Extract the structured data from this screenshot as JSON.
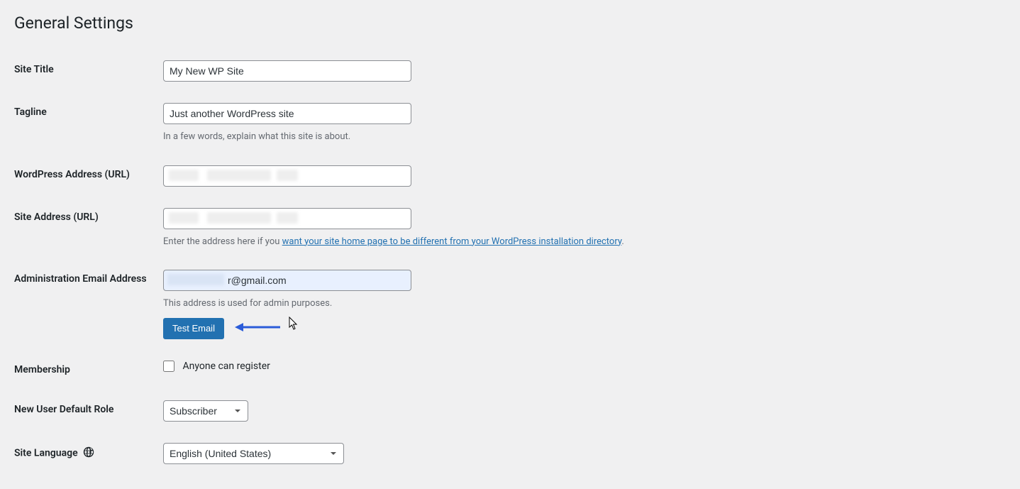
{
  "page_title": "General Settings",
  "fields": {
    "site_title": {
      "label": "Site Title",
      "value": "My New WP Site"
    },
    "tagline": {
      "label": "Tagline",
      "value": "Just another WordPress site",
      "description": "In a few words, explain what this site is about."
    },
    "wp_address": {
      "label": "WordPress Address (URL)",
      "value": ""
    },
    "site_address": {
      "label": "Site Address (URL)",
      "value": "",
      "desc_prefix": "Enter the address here if you ",
      "desc_link": "want your site home page to be different from your WordPress installation directory",
      "desc_suffix": "."
    },
    "admin_email": {
      "label": "Administration Email Address",
      "value": "r@gmail.com",
      "description": "This address is used for admin purposes.",
      "button_label": "Test Email"
    },
    "membership": {
      "label": "Membership",
      "checkbox_label": "Anyone can register",
      "checked": false
    },
    "default_role": {
      "label": "New User Default Role",
      "selected": "Subscriber"
    },
    "site_language": {
      "label": "Site Language",
      "selected": "English (United States)"
    }
  }
}
